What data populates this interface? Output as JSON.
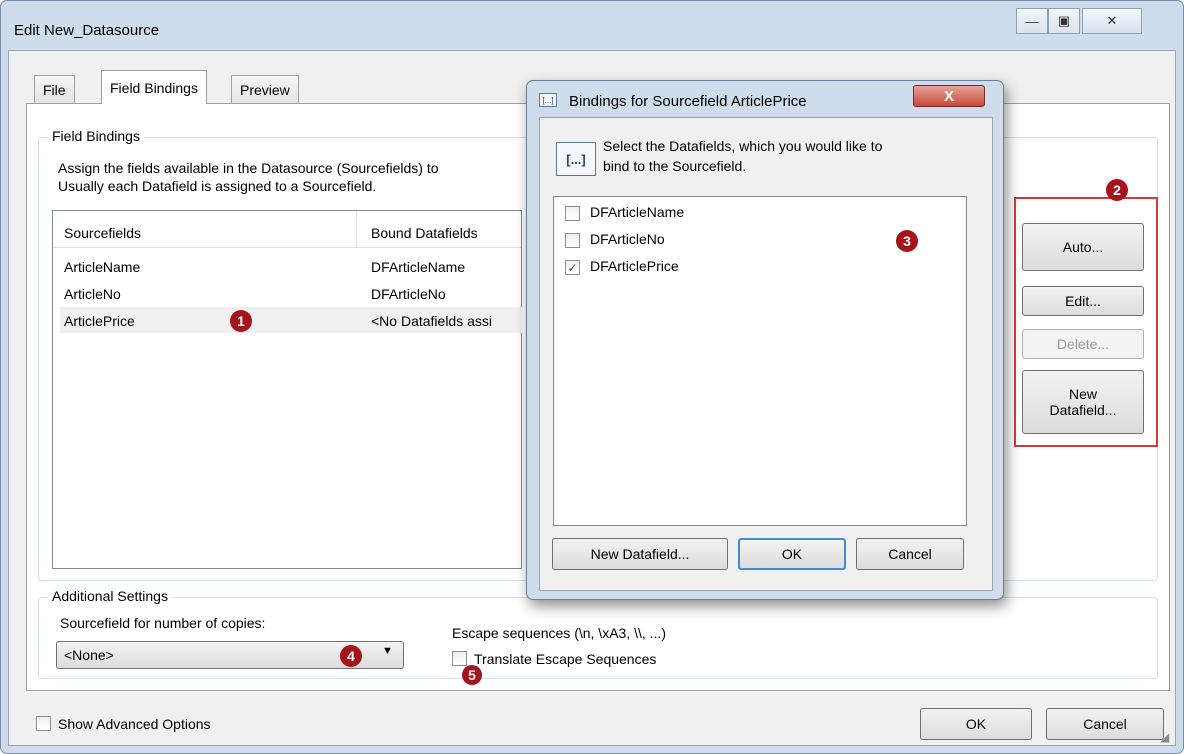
{
  "window": {
    "title": "Edit New_Datasource",
    "minimize": "—",
    "maximize": "▣",
    "close": "✕"
  },
  "tabs": [
    "File",
    "Field Bindings",
    "Preview"
  ],
  "field_bindings": {
    "group_label": "Field Bindings",
    "description_line1": "Assign the fields available in the Datasource (Sourcefields) to",
    "description_line2": "Usually each Datafield is assigned to a Sourcefield.",
    "columns": [
      "Sourcefields",
      "Bound Datafields"
    ],
    "rows": [
      {
        "source": "ArticleName",
        "bound": "DFArticleName"
      },
      {
        "source": "ArticleNo",
        "bound": "DFArticleNo"
      },
      {
        "source": "ArticlePrice",
        "bound": "<No Datafields assi"
      }
    ]
  },
  "side_buttons": {
    "auto": "Auto...",
    "edit": "Edit...",
    "delete": "Delete...",
    "new_line1": "New",
    "new_line2": "Datafield..."
  },
  "additional": {
    "group_label": "Additional Settings",
    "copies_label": "Sourcefield for number of copies:",
    "copies_value": "<None>",
    "escape_label": "Escape sequences (\\n, \\xA3, \\\\, ...)",
    "translate_label": "Translate Escape Sequences"
  },
  "footer": {
    "advanced_label": "Show Advanced Options",
    "ok": "OK",
    "cancel": "Cancel"
  },
  "dialog": {
    "title": "Bindings for Sourcefield ArticlePrice",
    "close": "X",
    "icon_text": "[...]",
    "instruction_line1": "Select the Datafields, which you would like to",
    "instruction_line2": "bind to the Sourcefield.",
    "items": [
      {
        "label": "DFArticleName",
        "checked": false
      },
      {
        "label": "DFArticleNo",
        "checked": false
      },
      {
        "label": "DFArticlePrice",
        "checked": true
      }
    ],
    "new_datafield": "New Datafield...",
    "ok": "OK",
    "cancel": "Cancel"
  },
  "markers": [
    "1",
    "2",
    "3",
    "4",
    "5"
  ],
  "colors": {
    "marker": "#a3141b",
    "highlight_box": "#d03a3a",
    "window_frame": "#cfdceb"
  }
}
